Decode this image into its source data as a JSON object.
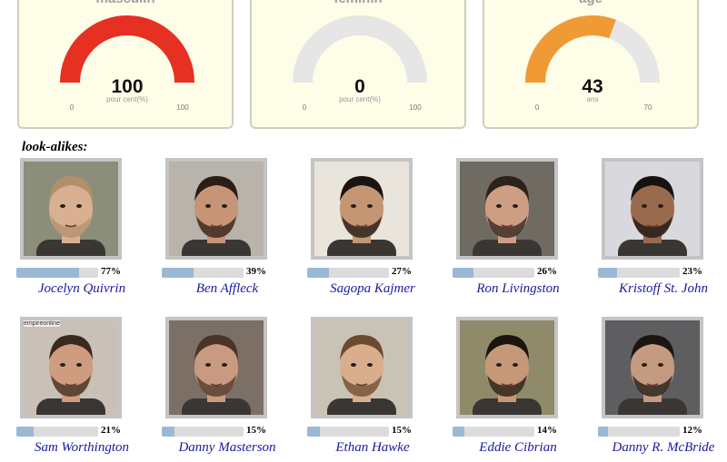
{
  "gauges": [
    {
      "title": "masculin",
      "value": "100",
      "unit": "pour cent(%)",
      "min": "0",
      "max": "100",
      "level": 1.0,
      "color": "#e63022"
    },
    {
      "title": "féminin",
      "value": "0",
      "unit": "pour cent(%)",
      "min": "0",
      "max": "100",
      "level": 0.0,
      "color": "#e63022"
    },
    {
      "title": "âge",
      "value": "43",
      "unit": "ans",
      "min": "0",
      "max": "70",
      "level": 0.614,
      "color": "#f09a36"
    }
  ],
  "track_color": "#e6e6e6",
  "lookalikes_heading": "look-alikes:",
  "people": [
    {
      "name": "Jocelyn Quivrin",
      "percent_label": "77%",
      "percent": 77,
      "photo": "portrait-photo",
      "hair": "#b0906a",
      "skin": "#d9b192",
      "bg": "#8a8e7a"
    },
    {
      "name": "Ben Affleck",
      "percent_label": "39%",
      "percent": 39,
      "photo": "portrait-photo",
      "hair": "#2a1e16",
      "skin": "#c79478",
      "bg": "#b8b3ab"
    },
    {
      "name": "Sagopa Kajmer",
      "percent_label": "27%",
      "percent": 27,
      "photo": "portrait-photo",
      "hair": "#1a1410",
      "skin": "#c59673",
      "bg": "#e9e4dc"
    },
    {
      "name": "Ron Livingston",
      "percent_label": "26%",
      "percent": 26,
      "photo": "portrait-photo",
      "hair": "#2b221a",
      "skin": "#cd9e84",
      "bg": "#6f6a62"
    },
    {
      "name": "Kristoff St. John",
      "percent_label": "23%",
      "percent": 23,
      "photo": "portrait-photo",
      "hair": "#161210",
      "skin": "#9a6a4e",
      "bg": "#d9d9dd"
    },
    {
      "name": "Sam Worthington",
      "percent_label": "21%",
      "percent": 21,
      "photo": "portrait-photo",
      "hair": "#3a2a1e",
      "skin": "#cf9c80",
      "bg": "#c9c0b8",
      "caption": "empireonline"
    },
    {
      "name": "Danny Masterson",
      "percent_label": "15%",
      "percent": 15,
      "photo": "portrait-photo",
      "hair": "#4a3426",
      "skin": "#c99a82",
      "bg": "#7c6f66"
    },
    {
      "name": "Ethan Hawke",
      "percent_label": "15%",
      "percent": 15,
      "photo": "portrait-photo",
      "hair": "#6b4a2e",
      "skin": "#d8ae8e",
      "bg": "#c9c3b6"
    },
    {
      "name": "Eddie Cibrian",
      "percent_label": "14%",
      "percent": 14,
      "photo": "portrait-photo",
      "hair": "#1c140e",
      "skin": "#c6987a",
      "bg": "#8f8a6a"
    },
    {
      "name": "Danny R. McBride",
      "percent_label": "12%",
      "percent": 12,
      "photo": "portrait-photo",
      "hair": "#1c1612",
      "skin": "#c49a80",
      "bg": "#5e5e60"
    }
  ]
}
